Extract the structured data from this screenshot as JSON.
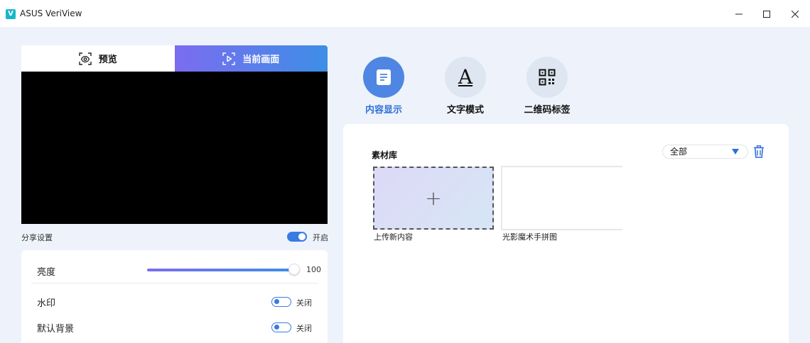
{
  "window": {
    "logo_letter": "V",
    "title": "ASUS VeriView"
  },
  "preview_tabs": [
    {
      "label": "预览",
      "icon": "eye-scan-icon",
      "active": false
    },
    {
      "label": "当前画面",
      "icon": "play-frame-icon",
      "active": true
    }
  ],
  "share": {
    "label": "分享设置",
    "state": "开启",
    "enabled": true
  },
  "settings": {
    "brightness_label": "亮度",
    "brightness_value": "100",
    "brightness_fraction": 1.0,
    "watermark_label": "水印",
    "watermark_state": "关闭",
    "default_bg_label": "默认背景",
    "default_bg_state": "关闭"
  },
  "modes": [
    {
      "label": "内容显示",
      "icon": "document-icon",
      "active": true
    },
    {
      "label": "文字模式",
      "icon": "letter-a-icon",
      "glyph": "A",
      "active": false
    },
    {
      "label": "二维码标签",
      "icon": "qr-code-icon",
      "active": false
    }
  ],
  "library": {
    "title": "素材库",
    "filter_value": "全部",
    "upload_label": "上传新内容",
    "upload_icon": "plus-icon",
    "items": [
      {
        "label": "光影魔术手拼图"
      }
    ]
  },
  "colors": {
    "accent": "#2f6fd8",
    "accent_gradient_start": "#7b6cf0",
    "accent_gradient_end": "#3d8ee6",
    "background": "#eef3fb"
  }
}
